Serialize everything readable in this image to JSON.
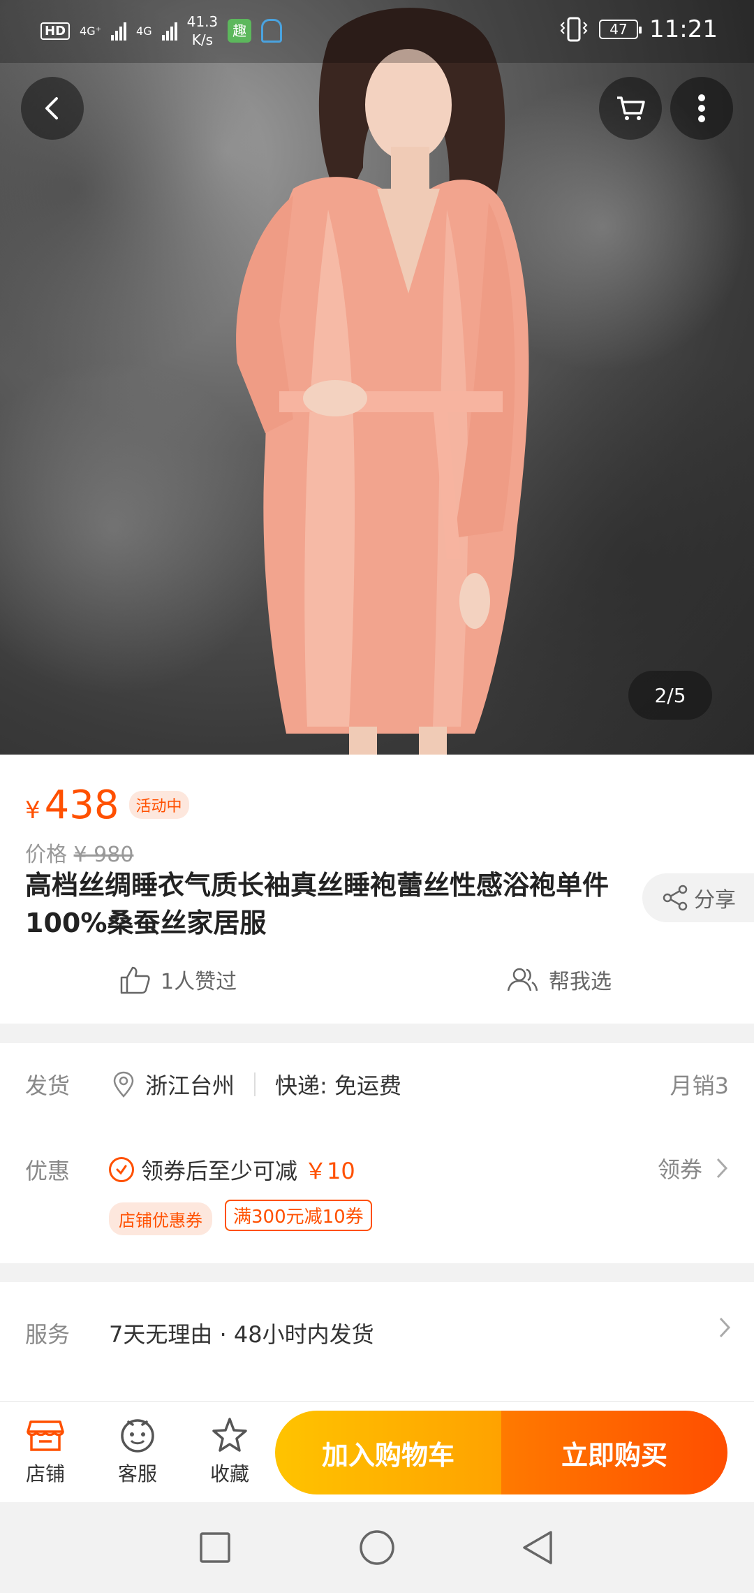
{
  "status_bar": {
    "hd": "HD",
    "net1": "4G⁺",
    "net2": "4G",
    "speed_value": "41.3",
    "speed_unit": "K/s",
    "app_icon_1": "趣",
    "battery": "47",
    "time": "11:21"
  },
  "header": {
    "back_icon": "chevron-left-icon",
    "cart_icon": "cart-icon",
    "more_icon": "more-vertical-icon"
  },
  "gallery": {
    "pager": "2/5"
  },
  "price": {
    "currency": "¥",
    "value": "438",
    "badge": "活动中",
    "orig_label": "价格",
    "orig_value": "¥ 980"
  },
  "product": {
    "title": "高档丝绸睡衣气质长袖真丝睡袍蕾丝性感浴袍单件100%桑蚕丝家居服",
    "share_label": "分享",
    "likes": "1人赞过",
    "help_choose": "帮我选"
  },
  "shipping": {
    "label": "发货",
    "location": "浙江台州",
    "express": "快递: 免运费",
    "monthly_sales": "月销3"
  },
  "promo": {
    "label": "优惠",
    "text": "领券后至少可减",
    "amount": "￥10",
    "get_coupon": "领券",
    "tag_store": "店铺优惠券",
    "tag_deal": "满300元减10券"
  },
  "service": {
    "label": "服务",
    "text": "7天无理由 · 48小时内发货"
  },
  "actionbar": {
    "store": "店铺",
    "service": "客服",
    "favorite": "收藏",
    "add_to_cart": "加入购物车",
    "buy_now": "立即购买"
  },
  "colors": {
    "accent": "#ff5000",
    "cart_button": "#ffb300",
    "buy_button": "#ff5a00"
  }
}
